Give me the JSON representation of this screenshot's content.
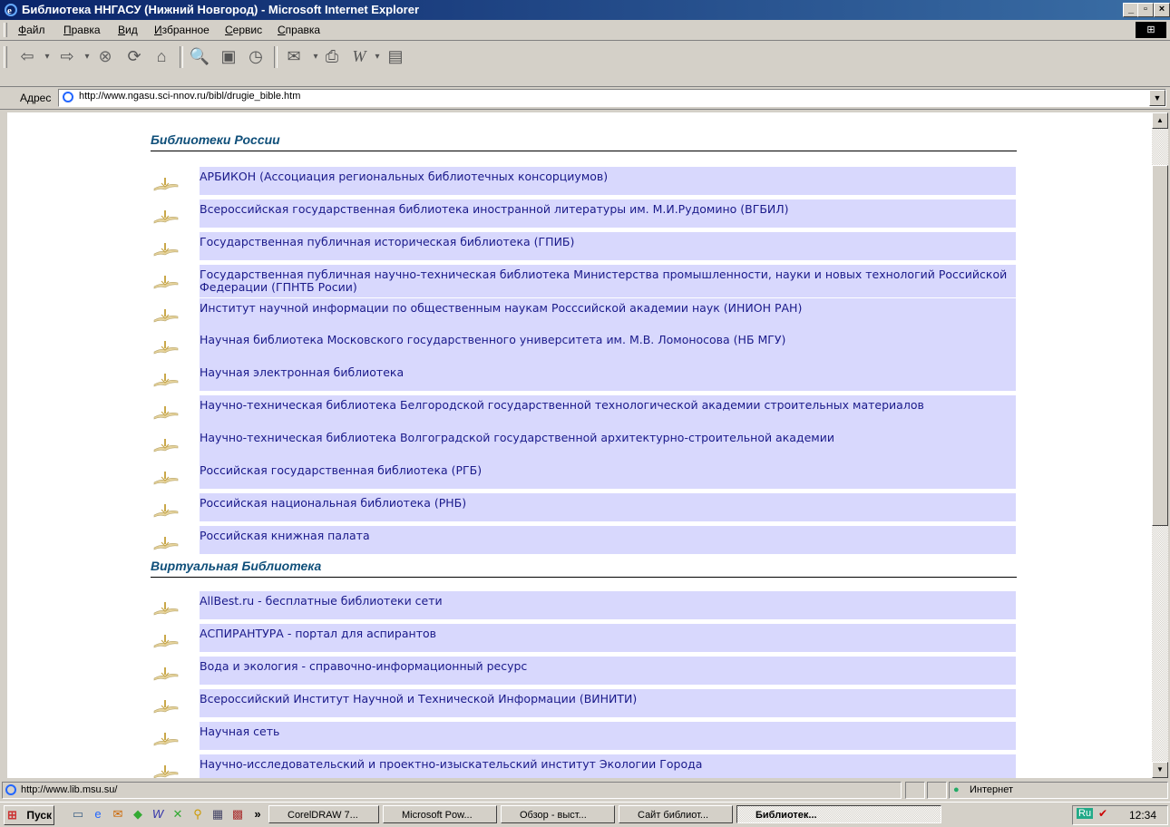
{
  "window": {
    "title": "Библиотека ННГАСУ (Нижний Новгород) - Microsoft Internet Explorer"
  },
  "title_buttons": [
    "_",
    "▫",
    "×"
  ],
  "menu": [
    "Файл",
    "Правка",
    "Вид",
    "Избранное",
    "Сервис",
    "Справка"
  ],
  "address": {
    "label": "Адрес",
    "url": "http://www.ngasu.sci-nnov.ru/bibl/drugie_bible.htm"
  },
  "sections": [
    {
      "title": "Библиотеки России",
      "links": [
        "АРБИКОН (Ассоциация региональных библиотечных консорциумов)",
        "Всероссийская государственная библиотека иностранной литературы им. М.И.Рудомино (ВГБИЛ)",
        "Государственная публичная историческая библиотека (ГПИБ)",
        "Государственная публичная научно-техническая библиотека Министерства промышленности, науки и новых технологий Российской Федерации (ГПНТБ Росии)",
        "Институт научной информации по общественным наукам Росссийской академии наук (ИНИОН РАН)",
        "Научная библиотека Московского государственного университета им. М.В. Ломоносова (НБ МГУ)",
        "Научная электронная библиотека",
        "Научно-техническая библиотека Белгородской государственной технологической академии строительных материалов",
        "Научно-техническая библиотека Волгоградской государственной архитектурно-строительной академии",
        "Российская государственная библиотека (РГБ)",
        "Российская национальная библиотека (РНБ)",
        "Российская книжная палата"
      ]
    },
    {
      "title": "Виртуальная Библиотека",
      "links": [
        "AllBest.ru - бесплатные библиотеки сети",
        "АСПИРАНТУРА - портал для аспирантов",
        "Вода и экология - справочно-информационный ресурс",
        "Всероссийский Институт Научной и Технической Информации (ВИНИТИ)",
        "Научная сеть",
        "Научно-исследовательский и проектно-изыскательский институт Экологии Города"
      ]
    }
  ],
  "status": {
    "text": "http://www.lib.msu.su/",
    "zone": "Интернет"
  },
  "taskbar": {
    "start": "Пуск",
    "chevron": "»",
    "tasks": [
      "CorelDRAW 7...",
      "Microsoft Pow...",
      "Обзор - выст...",
      "Сайт библиот...",
      "Библиотек..."
    ],
    "lang": "Ru",
    "clock": "12:34"
  }
}
